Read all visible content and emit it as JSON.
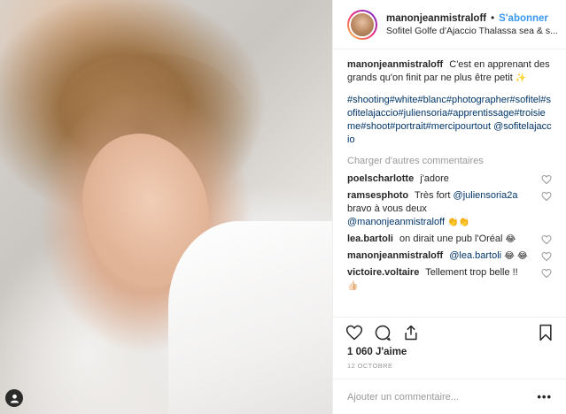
{
  "header": {
    "username": "manonjeanmistraloff",
    "separator": "•",
    "follow_label": "S'abonner",
    "location": "Sofitel Golfe d'Ajaccio Thalassa sea & s..."
  },
  "caption": {
    "username": "manonjeanmistraloff",
    "text": "C'est en apprenant des grands qu'on finit par ne plus être petit",
    "sparkle": "✨",
    "hashtags": "#shooting#white#blanc#photographer#sofitel#sofitelajaccio#juliensoria#apprentissage#troisieme#shoot#portrait#mercipourtout",
    "mention": "@sofitelajaccio"
  },
  "load_more_label": "Charger d'autres commentaires",
  "comments": [
    {
      "username": "poelscharlotte",
      "text": "j'adore",
      "mention": "",
      "emoji": ""
    },
    {
      "username": "ramsesphoto",
      "text": "Très fort",
      "mention": "@juliensoria2a",
      "text2": "bravo à vous deux",
      "mention2": "@manonjeanmistraloff",
      "emoji": "👏👏"
    },
    {
      "username": "lea.bartoli",
      "text": "on dirait une pub l'Oréal",
      "mention": "",
      "emoji": "😂"
    },
    {
      "username": "manonjeanmistraloff",
      "text": "",
      "mention": "@lea.bartoli",
      "emoji": "😂 😂"
    },
    {
      "username": "victoire.voltaire",
      "text": "Tellement trop belle !!",
      "mention": "",
      "emoji": "👍🏻"
    }
  ],
  "likes_label": "1 060 J'aime",
  "date_label": "12 OCTOBRE",
  "add_comment": {
    "placeholder": "Ajouter un commentaire...",
    "more": "•••"
  },
  "icons": [
    "heart-icon",
    "comment-icon",
    "share-icon",
    "bookmark-icon",
    "user-tag-icon",
    "more-icon"
  ]
}
